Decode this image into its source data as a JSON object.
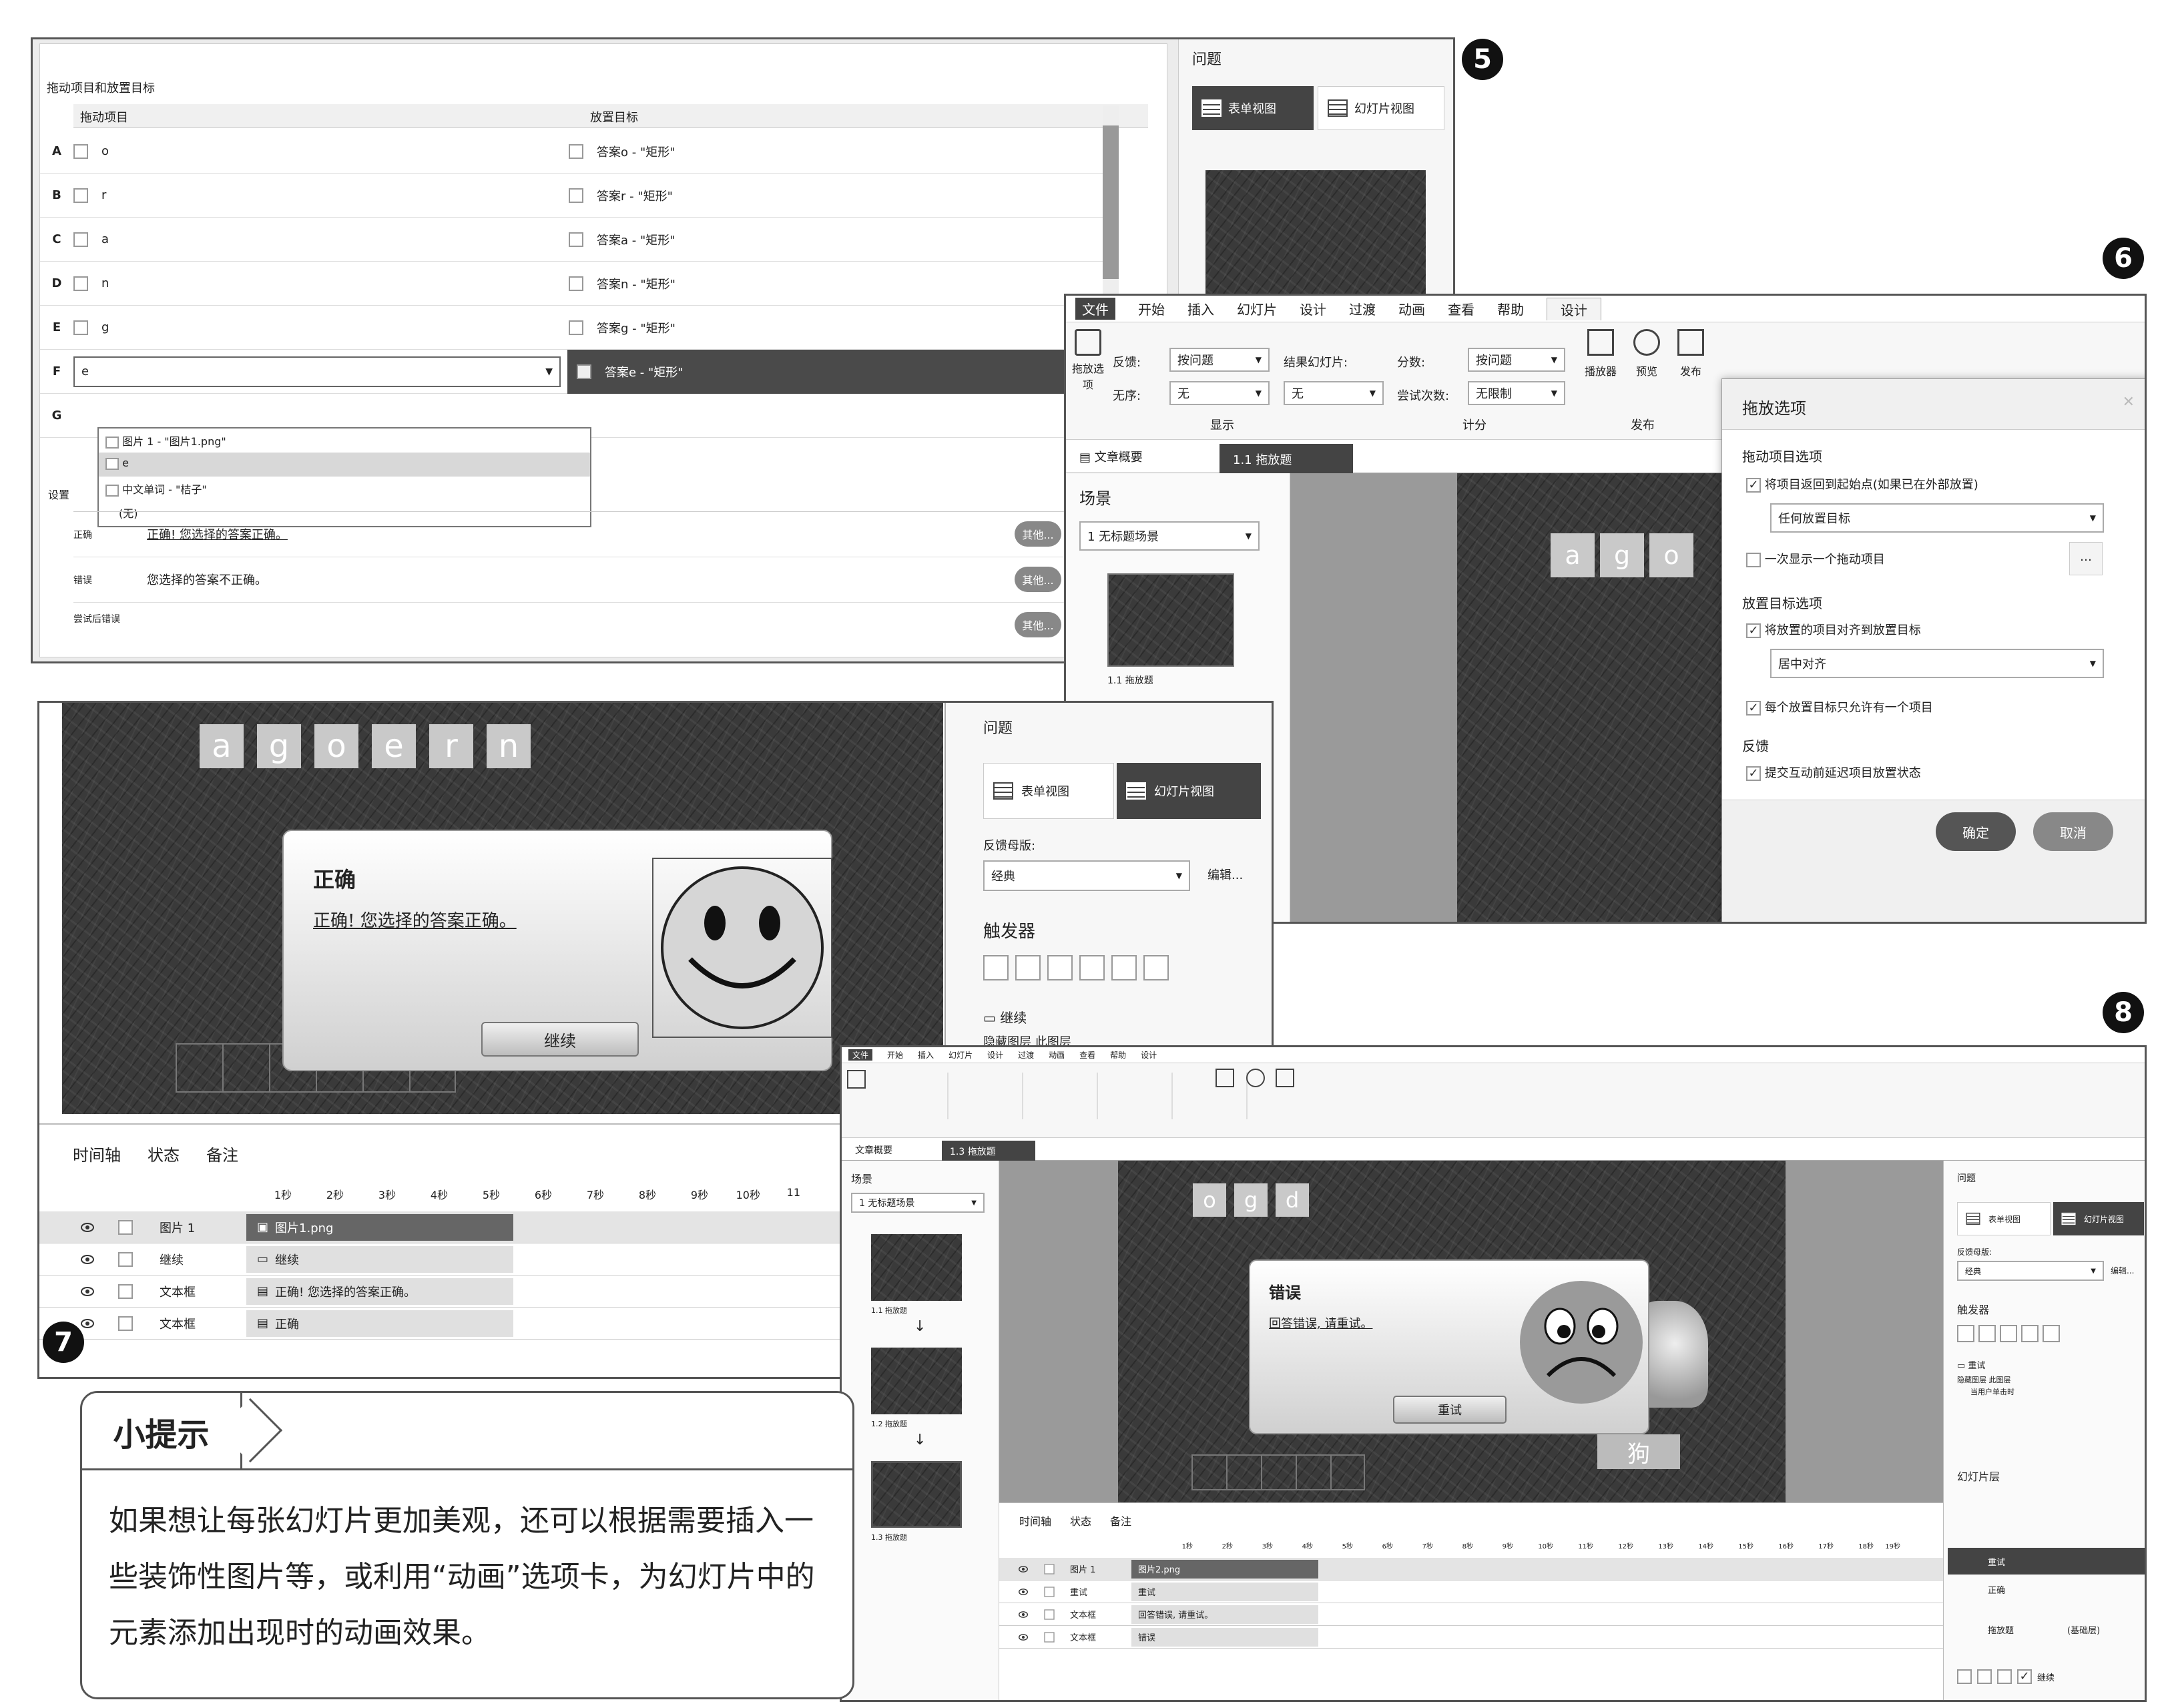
{
  "s5": {
    "badge": "5",
    "section_title": "拖动项目和放置目标",
    "col_drag": "拖动项目",
    "col_drop": "放置目标",
    "rows": [
      {
        "letter": "A",
        "item": "o",
        "target": "答案o - \"矩形\""
      },
      {
        "letter": "B",
        "item": "r",
        "target": "答案r - \"矩形\""
      },
      {
        "letter": "C",
        "item": "a",
        "target": "答案a - \"矩形\""
      },
      {
        "letter": "D",
        "item": "n",
        "target": "答案n - \"矩形\""
      },
      {
        "letter": "E",
        "item": "g",
        "target": "答案g - \"矩形\""
      },
      {
        "letter": "F",
        "item": "e",
        "target": "答案e - \"矩形\""
      },
      {
        "letter": "G",
        "item": "",
        "target": ""
      }
    ],
    "dropdown_options": [
      "图片 1 - \"图片1.png\"",
      "e",
      "中文单词 - \"桔子\"",
      "(无)"
    ],
    "settings_label": "设置",
    "feedback": [
      {
        "label": "正确",
        "text": "正确! 您选择的答案正确。",
        "btn": "其他..."
      },
      {
        "label": "错误",
        "text": "您选择的答案不正确。",
        "btn": "其他..."
      },
      {
        "label": "尝试后错误",
        "text": "",
        "btn": "其他..."
      }
    ],
    "panel_title": "问题",
    "view_form": "表单视图",
    "view_slide": "幻灯片视图"
  },
  "s6": {
    "badge": "6",
    "ribbon_tabs": [
      "文件",
      "开始",
      "插入",
      "幻灯片",
      "设计",
      "过渡",
      "动画",
      "查看",
      "帮助",
      "设计"
    ],
    "feedback_label": "反馈:",
    "feedback_value": "按问题",
    "shuffle_label": "无序:",
    "shuffle_value": "无",
    "finish_label": "结果幻灯片:",
    "finish_value": "无",
    "score_label": "分数:",
    "score_value": "按问题",
    "attempts_label": "尝试次数:",
    "attempts_value": "无限制",
    "drag_options_btn": "拖放选项",
    "group_display": "显示",
    "group_score": "计分",
    "group_publish": "发布",
    "btn_player": "播放器",
    "btn_preview": "预览",
    "btn_publish": "发布",
    "doc_tab": "文章概要",
    "slide_tab": "1.1 拖放题",
    "scene_title": "场景",
    "scene_select": "1 无标题场景",
    "thumb_label": "1.1 拖放题",
    "slide_tiles": [
      "a",
      "g",
      "o"
    ],
    "dialog": {
      "title": "拖放选项",
      "drag_section": "拖动项目选项",
      "opt_return": "将项目返回到起始点(如果已在外部放置)",
      "return_combo": "任何放置目标",
      "opt_one_at_time": "一次显示一个拖动项目",
      "drop_section": "放置目标选项",
      "opt_snap": "将放置的项目对齐到放置目标",
      "snap_combo": "居中对齐",
      "opt_one_item": "每个放置目标只允许有一个项目",
      "feedback_section": "反馈",
      "opt_delay": "提交互动前延迟项目放置状态",
      "ok": "确定",
      "cancel": "取消"
    }
  },
  "s7": {
    "badge": "7",
    "tiles": [
      "a",
      "g",
      "o",
      "e",
      "r",
      "n"
    ],
    "popup_title": "正确",
    "popup_text": "正确! 您选择的答案正确。",
    "popup_btn": "继续",
    "panel_title": "问题",
    "view_form": "表单视图",
    "view_slide": "幻灯片视图",
    "feedback_master_label": "反馈母版:",
    "feedback_master_value": "经典",
    "edit_btn": "编辑...",
    "triggers_title": "触发器",
    "trigger_item": "继续",
    "trigger_sub": "隐藏图层 此图层",
    "timeline_tabs": [
      "时间轴",
      "状态",
      "备注"
    ],
    "ticks": [
      "1秒",
      "2秒",
      "3秒",
      "4秒",
      "5秒",
      "6秒",
      "7秒",
      "8秒",
      "9秒",
      "10秒",
      "11"
    ],
    "tl_rows": [
      {
        "name": "图片 1",
        "bar": "图片1.png"
      },
      {
        "name": "继续",
        "bar": "继续"
      },
      {
        "name": "文本框",
        "bar": "正确! 您选择的答案正确。"
      },
      {
        "name": "文本框",
        "bar": "正确"
      }
    ]
  },
  "s8": {
    "badge": "8",
    "ribbon_tabs": [
      "文件",
      "开始",
      "插入",
      "幻灯片",
      "设计",
      "过渡",
      "动画",
      "查看",
      "帮助",
      "设计"
    ],
    "scene_title": "场景",
    "scene_select": "1 无标题场景",
    "thumb_labels": [
      "1.1 拖放题",
      "1.2 拖放题",
      "1.3 拖放题"
    ],
    "doc_tab": "文章概要",
    "slide_tab": "1.3 拖放题",
    "tiles": [
      "o",
      "g",
      "d"
    ],
    "popup_title": "错误",
    "popup_text": "回答错误, 请重试。",
    "popup_btn": "重试",
    "word_label": "狗",
    "panel_title": "问题",
    "view_form": "表单视图",
    "view_slide": "幻灯片视图",
    "feedback_master_label": "反馈母版:",
    "feedback_master_value": "经典",
    "edit_btn": "编辑...",
    "triggers_title": "触发器",
    "trigger_item": "重试",
    "trigger_sub": "隐藏图层 此图层",
    "trigger_sub2": "当用户单击时",
    "layers_title": "幻灯片层",
    "layers": [
      "重试",
      "正确",
      "拖放题"
    ],
    "layer_base_note": "(基础层)",
    "layer_ctrl": "继续",
    "timeline_tabs": [
      "时间轴",
      "状态",
      "备注"
    ],
    "ticks": [
      "1秒",
      "2秒",
      "3秒",
      "4秒",
      "5秒",
      "6秒",
      "7秒",
      "8秒",
      "9秒",
      "10秒",
      "11秒",
      "12秒",
      "13秒",
      "14秒",
      "15秒",
      "16秒",
      "17秒",
      "18秒",
      "19秒"
    ],
    "tl_rows": [
      {
        "name": "图片 1",
        "bar": "图片2.png"
      },
      {
        "name": "重试",
        "bar": "重试"
      },
      {
        "name": "文本框",
        "bar": "回答错误, 请重试。"
      },
      {
        "name": "文本框",
        "bar": "错误"
      }
    ]
  },
  "tip": {
    "title": "小提示",
    "body": "如果想让每张幻灯片更加美观，还可以根据需要插入一些装饰性图片等，或利用“动画”选项卡，为幻灯片中的元素添加出现时的动画效果。"
  }
}
